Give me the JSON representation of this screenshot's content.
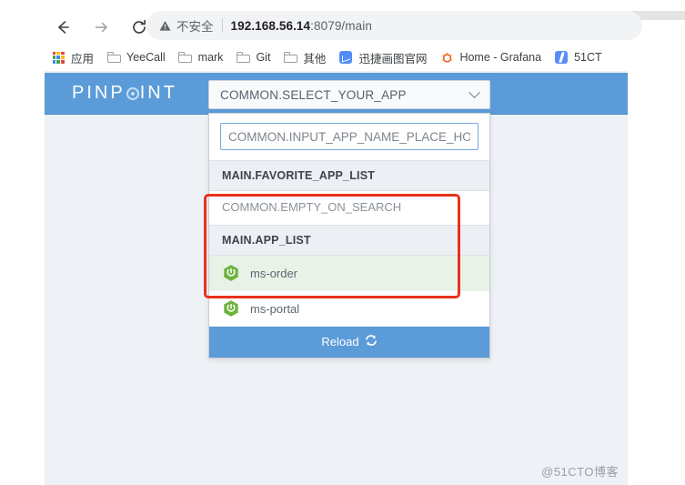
{
  "browser": {
    "nav": {
      "back_icon": "arrow-left-icon",
      "forward_icon": "arrow-right-icon",
      "reload_icon": "reload-icon"
    },
    "omnibox": {
      "security_icon": "warning-triangle-icon",
      "security_label": "不安全",
      "url_host": "192.168.56.14",
      "url_rest": ":8079/main"
    },
    "bookmarks": [
      {
        "label": "应用",
        "icon": "apps-grid-icon"
      },
      {
        "label": "YeeCall",
        "icon": "folder-icon"
      },
      {
        "label": "mark",
        "icon": "folder-icon"
      },
      {
        "label": "Git",
        "icon": "folder-icon"
      },
      {
        "label": "其他",
        "icon": "folder-icon"
      },
      {
        "label": "迅捷画图官网",
        "icon": "blue-chart-icon"
      },
      {
        "label": "Home - Grafana",
        "icon": "grafana-icon"
      },
      {
        "label": "51CT",
        "icon": "blue-pen-icon"
      }
    ]
  },
  "page": {
    "brand": {
      "prefix": "PINP",
      "suffix": "INT",
      "target_icon": "target-dot-icon"
    },
    "app_selector": {
      "button_label": "COMMON.SELECT_YOUR_APP",
      "chevron_icon": "chevron-down-icon",
      "search_placeholder": "COMMON.INPUT_APP_NAME_PLACE_HOL",
      "search_value": "",
      "favorite_section_label": "MAIN.FAVORITE_APP_LIST",
      "favorite_empty_label": "COMMON.EMPTY_ON_SEARCH",
      "app_section_label": "MAIN.APP_LIST",
      "apps": [
        {
          "name": "ms-order",
          "icon": "spring-boot-icon",
          "hovered": true
        },
        {
          "name": "ms-portal",
          "icon": "spring-boot-icon",
          "hovered": false
        }
      ],
      "reload_label": "Reload",
      "reload_icon": "refresh-icon"
    },
    "annotation": {
      "highlight_color": "#e8321c"
    }
  },
  "watermark": {
    "text": "@51CTO博客"
  },
  "colors": {
    "brand_blue": "#5b9bd8",
    "page_bg": "#eef1f5",
    "hover_green": "#e8f2e6",
    "spring_green": "#6db33f",
    "highlight_red": "#e8321c"
  }
}
